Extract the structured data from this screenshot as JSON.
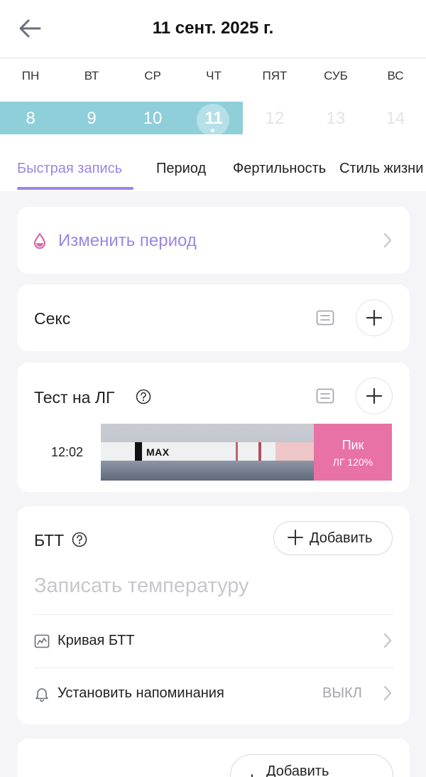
{
  "header": {
    "title": "11 сент. 2025 г."
  },
  "weekdays": [
    "ПН",
    "ВТ",
    "СР",
    "ЧТ",
    "ПЯТ",
    "СУБ",
    "ВС"
  ],
  "dates": [
    "8",
    "9",
    "10",
    "11",
    "12",
    "13",
    "14"
  ],
  "tabs": [
    "Быстрая запись",
    "Период",
    "Фертильность",
    "Стиль жизни"
  ],
  "period_card": {
    "label": "Изменить период"
  },
  "sex_card": {
    "label": "Секс"
  },
  "lh_card": {
    "label": "Тест на ЛГ",
    "time": "12:02",
    "strip_marking": "MAX",
    "result_title": "Пик",
    "result_value": "ЛГ 120%"
  },
  "btt_card": {
    "label": "БТТ",
    "add_label": "Добавить",
    "placeholder": "Записать температуру",
    "curve_label": "Кривая БТТ",
    "reminder_label": "Установить напоминания",
    "reminder_value": "ВЫКЛ"
  },
  "next_card": {
    "add_label": "Добавить"
  },
  "colors": {
    "accent": "#9d85e6",
    "calendar_band": "#8ecfda",
    "peak": "#e871a6",
    "drop": "#d56aa6"
  }
}
